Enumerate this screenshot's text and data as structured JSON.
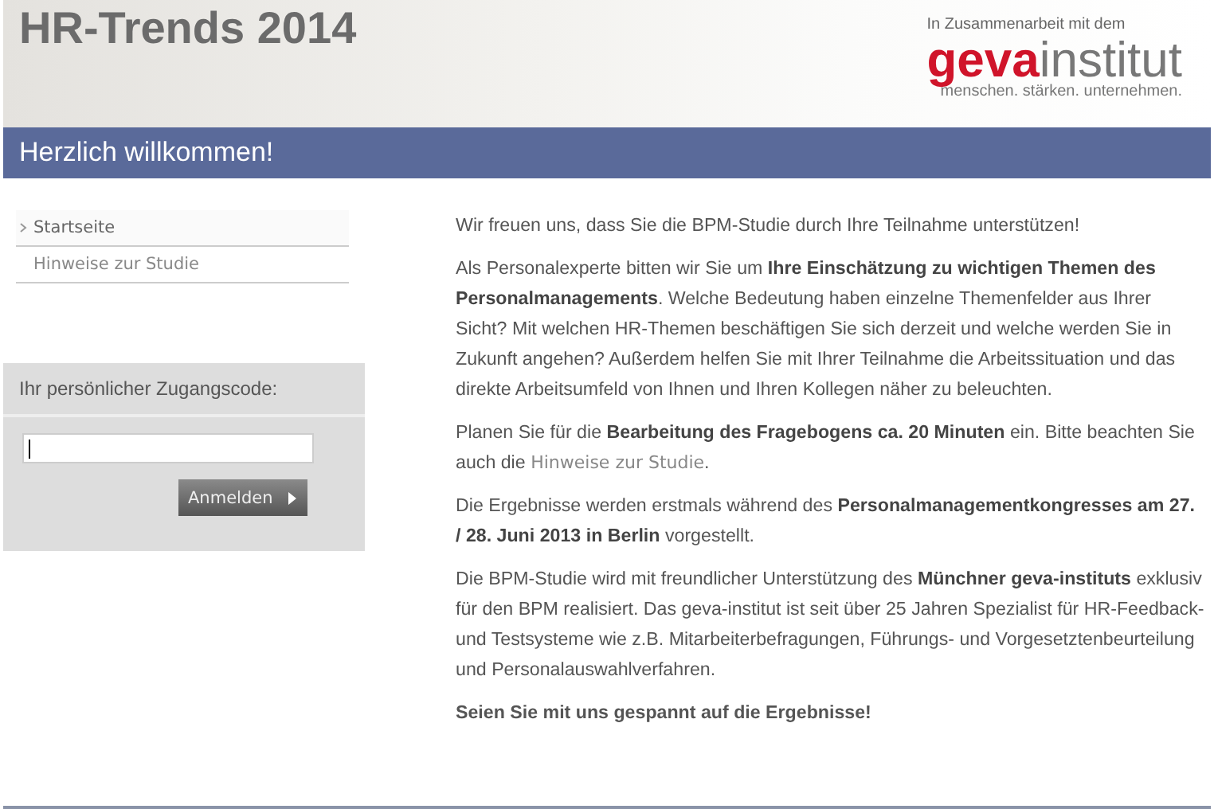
{
  "header": {
    "title": "HR-Trends 2014",
    "partner_note": "In Zusammenarbeit mit dem",
    "logo": {
      "bold": "geva",
      "light": "institut",
      "tagline": "menschen. stärken. unternehmen."
    }
  },
  "banner": {
    "title": "Herzlich willkommen!"
  },
  "sidebar": {
    "items": [
      {
        "label": "Startseite",
        "selected": true
      },
      {
        "label": "Hinweise zur Studie",
        "selected": false
      }
    ]
  },
  "login": {
    "label": "Ihr persönlicher Zugangscode:",
    "field": {
      "focused": true
    },
    "button": "Anmelden"
  },
  "content": {
    "paragraphs": [
      {
        "kind": "text",
        "text": "Wir freuen uns, dass Sie die BPM-Studie durch Ihre Teilnahme unterstützen!"
      },
      {
        "kind": "text",
        "text": "Als Personalexperte bitten wir Sie um **Ihre Einschätzung zu wichtigen Themen des Personalmanagements**. Welche Bedeutung haben einzelne Themenfelder aus Ihrer Sicht? Mit welchen HR-Themen beschäftigen Sie sich derzeit und welche werden Sie in Zukunft angehen? Außerdem helfen Sie mit Ihrer Teilnahme die Arbeitssituation und das direkte Arbeitsumfeld von Ihnen und Ihren Kollegen näher zu beleuchten."
      },
      {
        "kind": "link",
        "before": "Planen Sie für die **Bearbeitung des Fragebogens ca. 20 Minuten** ein. Bitte beachten Sie auch die",
        "link": "Hinweise zur Studie",
        "after": "."
      },
      {
        "kind": "text",
        "text": "Die Ergebnisse werden erstmals während des **Personalmanagementkongresses am 27. / 28. Juni 2013 in Berlin** vorgestellt."
      },
      {
        "kind": "text",
        "text": "Die BPM-Studie wird mit freundlicher Unterstützung des **Münchner geva-instituts** exklusiv für den BPM realisiert. Das geva-institut ist seit über 25 Jahren Spezialist für HR-Feedback- und Testsysteme wie z.B. Mitarbeiterbefragungen, Führungs- und Vorgesetztenbeurteilung und Personalauswahlverfahren."
      },
      {
        "kind": "emphasis",
        "text": "Seien Sie mit uns gespannt auf die Ergebnisse!"
      }
    ]
  }
}
